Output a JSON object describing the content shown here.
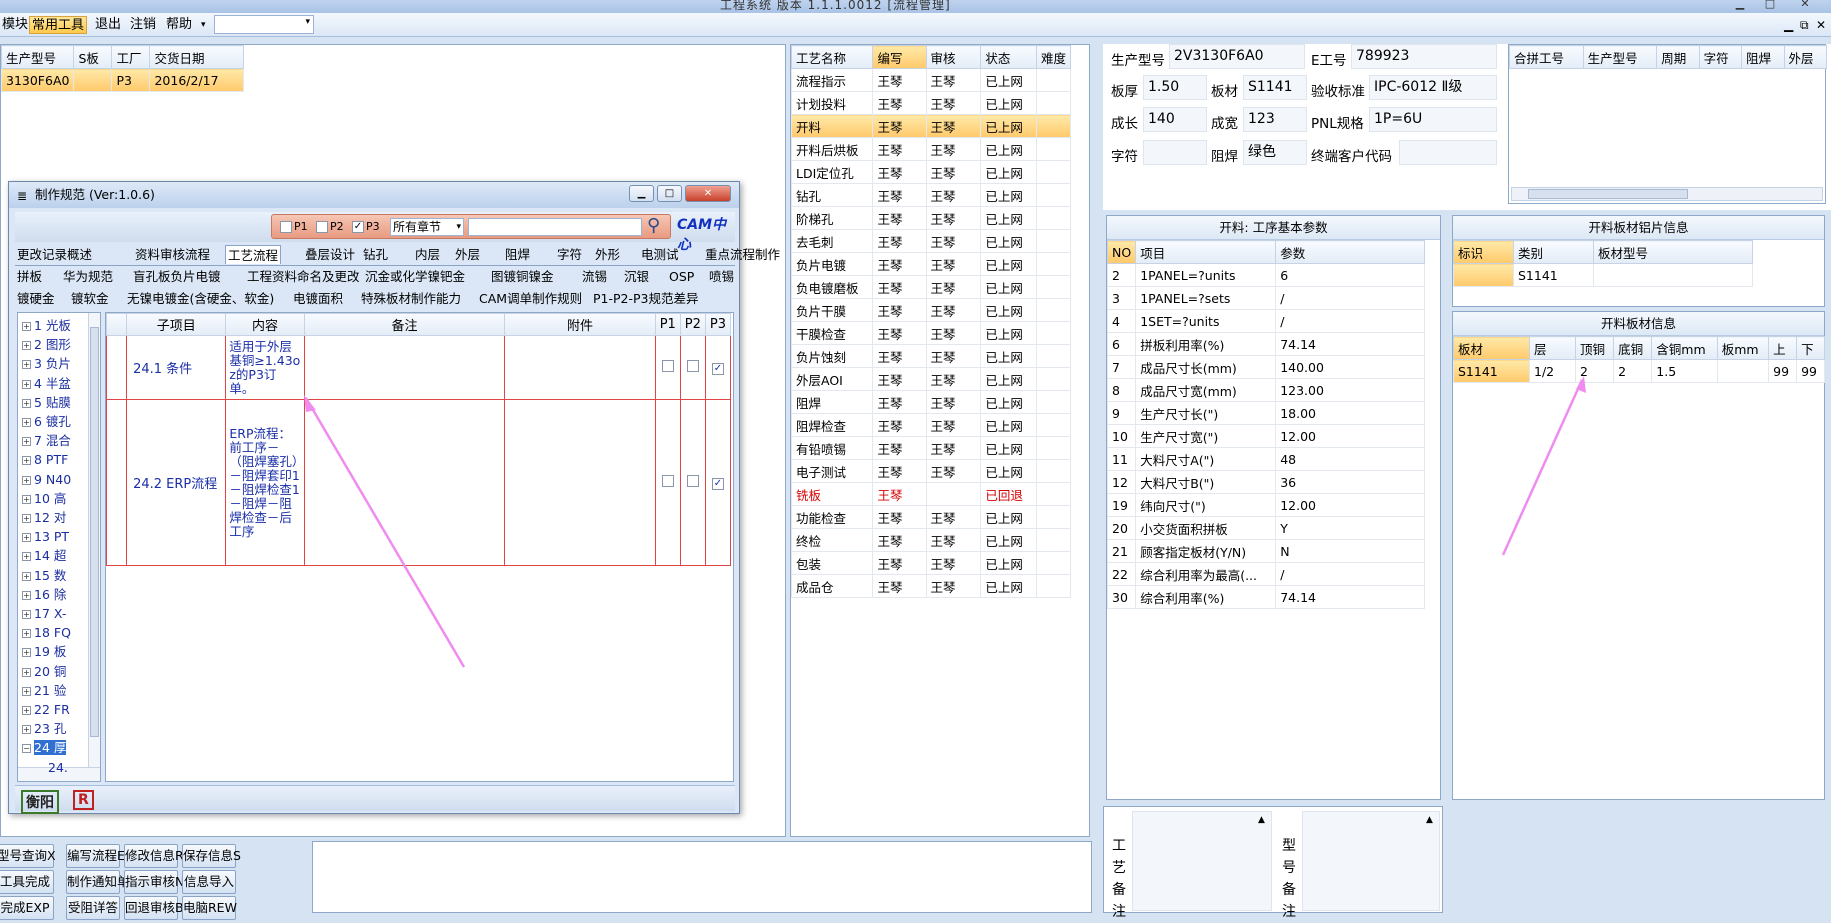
{
  "app": {
    "title": "工程系统 版本 1.1.1.0012 [流程管理]"
  },
  "menu": {
    "items": [
      {
        "label": "模块"
      },
      {
        "label": "常用工具"
      },
      {
        "label": "退出"
      },
      {
        "label": "注销"
      },
      {
        "label": "帮助"
      }
    ],
    "combo_value": ""
  },
  "orders": {
    "headers": [
      "生产型号",
      "S板",
      "工厂",
      "交货日期"
    ],
    "rows": [
      [
        "3130F6A0",
        "",
        "P3",
        "2016/2/17"
      ]
    ]
  },
  "dialog": {
    "title": "制作规范 (Ver:1.0.6)",
    "filters": {
      "p1": "P1",
      "p2": "P2",
      "p3": "P3",
      "chapter": "所有章节",
      "search": ""
    },
    "logo": "CAM中心",
    "tabs_row1": [
      "更改记录",
      "概述",
      "资料审核流程",
      "工艺流程",
      "叠层设计",
      "钻孔",
      "内层",
      "外层",
      "阻焊",
      "字符",
      "外形",
      "电测试",
      "重点流程制作"
    ],
    "tabs_row2": [
      "拼板",
      "华为规范",
      "盲孔板负片电镀",
      "工程资料命名及更改",
      "沉金或化学镍钯金",
      "图镀铜镍金",
      "流锡",
      "沉银",
      "OSP",
      "喷锡"
    ],
    "tabs_row3": [
      "镀硬金",
      "镀软金",
      "无镍电镀金(含硬金、软金)",
      "电镀面积",
      "特殊板材制作能力",
      "CAM调单制作规则",
      "P1-P2-P3规范差异"
    ],
    "tree": [
      "1 光板",
      "2 图形",
      "3 负片",
      "4 半盆",
      "5 贴膜",
      "6 镀孔",
      "7 混合",
      "8 PTF",
      "9 N40",
      "10 高",
      "12 对",
      "13 PT",
      "14 超",
      "15 数",
      "16 除",
      "17 X-",
      "18 FQ",
      "19 板",
      "20 铜",
      "21 验",
      "22 FR",
      "23 孔",
      "24 厚",
      "24.",
      "24."
    ],
    "spec_headers": [
      "子项目",
      "内容",
      "备注",
      "附件",
      "P1",
      "P2",
      "P3"
    ],
    "spec_rows": [
      {
        "sub": "24.1 条件",
        "content": "适用于外层基铜≥1.43oz的P3订单。",
        "remark": "",
        "attach": "",
        "p1": false,
        "p2": false,
        "p3": true
      },
      {
        "sub": "24.2 ERP流程",
        "content": "ERP流程：前工序－（阻焊塞孔）－阻焊套印1－阻焊检查1－阻焊－阻焊检查－后工序",
        "remark": "",
        "attach": "",
        "p1": false,
        "p2": false,
        "p3": true
      }
    ],
    "status": [
      "衡阳",
      "R"
    ]
  },
  "process": {
    "headers": [
      "工艺名称",
      "编写",
      "审核",
      "状态",
      "难度"
    ],
    "rows": [
      [
        "流程指示",
        "王琴",
        "王琴",
        "已上网",
        ""
      ],
      [
        "计划投料",
        "王琴",
        "王琴",
        "已上网",
        ""
      ],
      [
        "开料",
        "王琴",
        "王琴",
        "已上网",
        ""
      ],
      [
        "开料后烘板",
        "王琴",
        "王琴",
        "已上网",
        ""
      ],
      [
        "LDI定位孔",
        "王琴",
        "王琴",
        "已上网",
        ""
      ],
      [
        "钻孔",
        "王琴",
        "王琴",
        "已上网",
        ""
      ],
      [
        "阶梯孔",
        "王琴",
        "王琴",
        "已上网",
        ""
      ],
      [
        "去毛刺",
        "王琴",
        "王琴",
        "已上网",
        ""
      ],
      [
        "负片电镀",
        "王琴",
        "王琴",
        "已上网",
        ""
      ],
      [
        "负电镀磨板",
        "王琴",
        "王琴",
        "已上网",
        ""
      ],
      [
        "负片干膜",
        "王琴",
        "王琴",
        "已上网",
        ""
      ],
      [
        "干膜检查",
        "王琴",
        "王琴",
        "已上网",
        ""
      ],
      [
        "负片蚀刻",
        "王琴",
        "王琴",
        "已上网",
        ""
      ],
      [
        "外层AOI",
        "王琴",
        "王琴",
        "已上网",
        ""
      ],
      [
        "阻焊",
        "王琴",
        "王琴",
        "已上网",
        ""
      ],
      [
        "阻焊检查",
        "王琴",
        "王琴",
        "已上网",
        ""
      ],
      [
        "有铅喷锡",
        "王琴",
        "王琴",
        "已上网",
        ""
      ],
      [
        "电子测试",
        "王琴",
        "王琴",
        "已上网",
        ""
      ],
      [
        "铣板",
        "王琴",
        "",
        "已回退",
        ""
      ],
      [
        "功能检查",
        "王琴",
        "王琴",
        "已上网",
        ""
      ],
      [
        "终检",
        "王琴",
        "王琴",
        "已上网",
        ""
      ],
      [
        "包装",
        "王琴",
        "王琴",
        "已上网",
        ""
      ],
      [
        "成品仓",
        "王琴",
        "王琴",
        "已上网",
        ""
      ]
    ]
  },
  "info": {
    "model_label": "生产型号",
    "model": "2V3130F6A0",
    "eno_label": "E工号",
    "eno": "789923",
    "thick_label": "板厚",
    "thick": "1.50",
    "mat_label": "板材",
    "mat": "S1141",
    "std_label": "验收标准",
    "std": "IPC-6012 Ⅱ级",
    "len_label": "成长",
    "len": "140",
    "wid_label": "成宽",
    "wid": "123",
    "pnl_label": "PNL规格",
    "pnl": "1P=6U",
    "char_label": "字符",
    "char": "",
    "mask_label": "阻焊",
    "mask": "绿色",
    "cust_label": "终端客户代码",
    "cust": ""
  },
  "merge": {
    "headers": [
      "合拼工号",
      "生产型号",
      "周期",
      "字符",
      "阻焊",
      "外层"
    ]
  },
  "params": {
    "title": "开料: 工序基本参数",
    "headers": [
      "NO",
      "项目",
      "参数"
    ],
    "rows": [
      [
        "2",
        "1PANEL=?units",
        "6"
      ],
      [
        "3",
        "1PANEL=?sets",
        "/"
      ],
      [
        "4",
        "1SET=?units",
        "/"
      ],
      [
        "6",
        "拼板利用率(%)",
        "74.14"
      ],
      [
        "7",
        "成品尺寸长(mm)",
        "140.00"
      ],
      [
        "8",
        "成品尺寸宽(mm)",
        "123.00"
      ],
      [
        "9",
        "生产尺寸长(\")",
        "18.00"
      ],
      [
        "10",
        "生产尺寸宽(\")",
        "12.00"
      ],
      [
        "11",
        "大料尺寸A(\")",
        "48"
      ],
      [
        "12",
        "大料尺寸B(\")",
        "36"
      ],
      [
        "19",
        "纬向尺寸(\")",
        "12.00"
      ],
      [
        "20",
        "小交货面积拼板",
        "Y"
      ],
      [
        "21",
        "顾客指定板材(Y/N)",
        "N"
      ],
      [
        "22",
        "综合利用率为最高(...",
        "/"
      ],
      [
        "30",
        "综合利用率(%)",
        "74.14"
      ]
    ]
  },
  "sheet_info": {
    "title": "开料板材铝片信息",
    "headers": [
      "标识",
      "类别",
      "板材型号"
    ],
    "rows": [
      [
        "",
        "S1141",
        ""
      ]
    ]
  },
  "material": {
    "title": "开料板材信息",
    "headers": [
      "板材",
      "层",
      "顶铜",
      "底铜",
      "含铜mm",
      "板mm",
      "上",
      "下"
    ],
    "rows": [
      [
        "S1141",
        "1/2",
        "2",
        "2",
        "1.5",
        "",
        "99",
        "99"
      ]
    ]
  },
  "notes": {
    "process_label": "工艺备注",
    "model_label": "型号备注"
  },
  "buttons": {
    "r1": [
      "型号查询X",
      "编写流程E",
      "修改信息R",
      "保存信息S"
    ],
    "r2": [
      "工具完成",
      "制作通知单",
      "指示审核N",
      "信息导入"
    ],
    "r3": [
      "完成EXP",
      "受阻详答",
      "回退审核B",
      "电脑REW"
    ]
  }
}
